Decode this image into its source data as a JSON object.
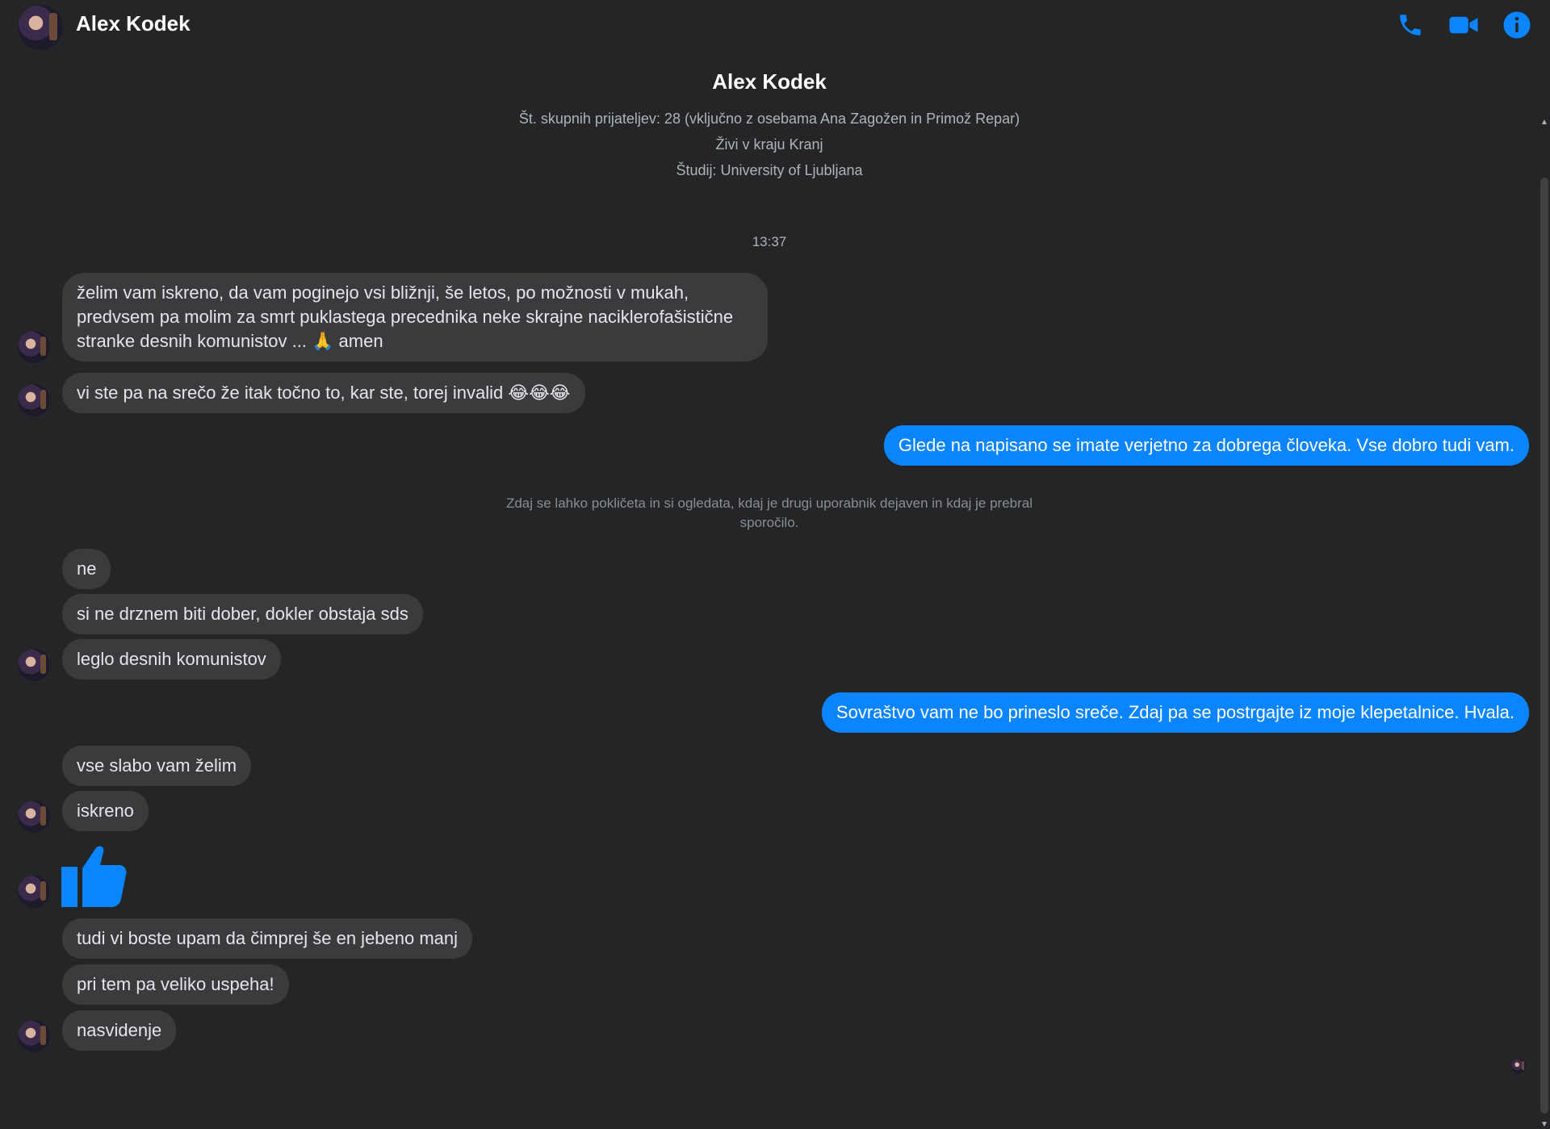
{
  "header": {
    "name": "Alex Kodek",
    "icons": [
      "phone-icon",
      "video-camera-icon",
      "info-icon"
    ],
    "accent_color": "#0a84ff"
  },
  "profile": {
    "name": "Alex Kodek",
    "mutual_friends": "Št. skupnih prijateljev: 28 (vključno z osebama Ana Zagožen in Primož Repar)",
    "lives_in": "Živi v kraju Kranj",
    "studied": "Študij: University of Ljubljana"
  },
  "timestamp": "13:37",
  "system_note": "Zdaj se lahko pokličeta in si ogledata, kdaj je drugi uporabnik dejaven in kdaj je prebral sporočilo.",
  "messages": {
    "m1": "želim vam iskreno, da vam poginejo vsi bližnji, še letos, po možnosti v mukah, predvsem pa molim za smrt puklastega precednika neke skrajne naciklerofašistične stranke desnih komunistov ... 🙏 amen",
    "m2": "vi ste pa na srečo že itak točno to, kar ste, torej invalid 😂😂😂",
    "m3": "Glede na napisano se imate verjetno za dobrega človeka. Vse dobro tudi vam.",
    "m4": "ne",
    "m5": "si ne drznem biti dober, dokler obstaja sds",
    "m6": "leglo desnih komunistov",
    "m7": "Sovraštvo vam ne bo prineslo sreče. Zdaj pa se postrgajte iz moje klepetalnice. Hvala.",
    "m8": "vse slabo vam želim",
    "m9": "iskreno",
    "m10_icon": "thumbs-up-icon",
    "m11": "tudi vi boste upam da čimprej še en jebeno manj",
    "m12": "pri tem pa veliko uspeha!",
    "m13": "nasvidenje"
  }
}
